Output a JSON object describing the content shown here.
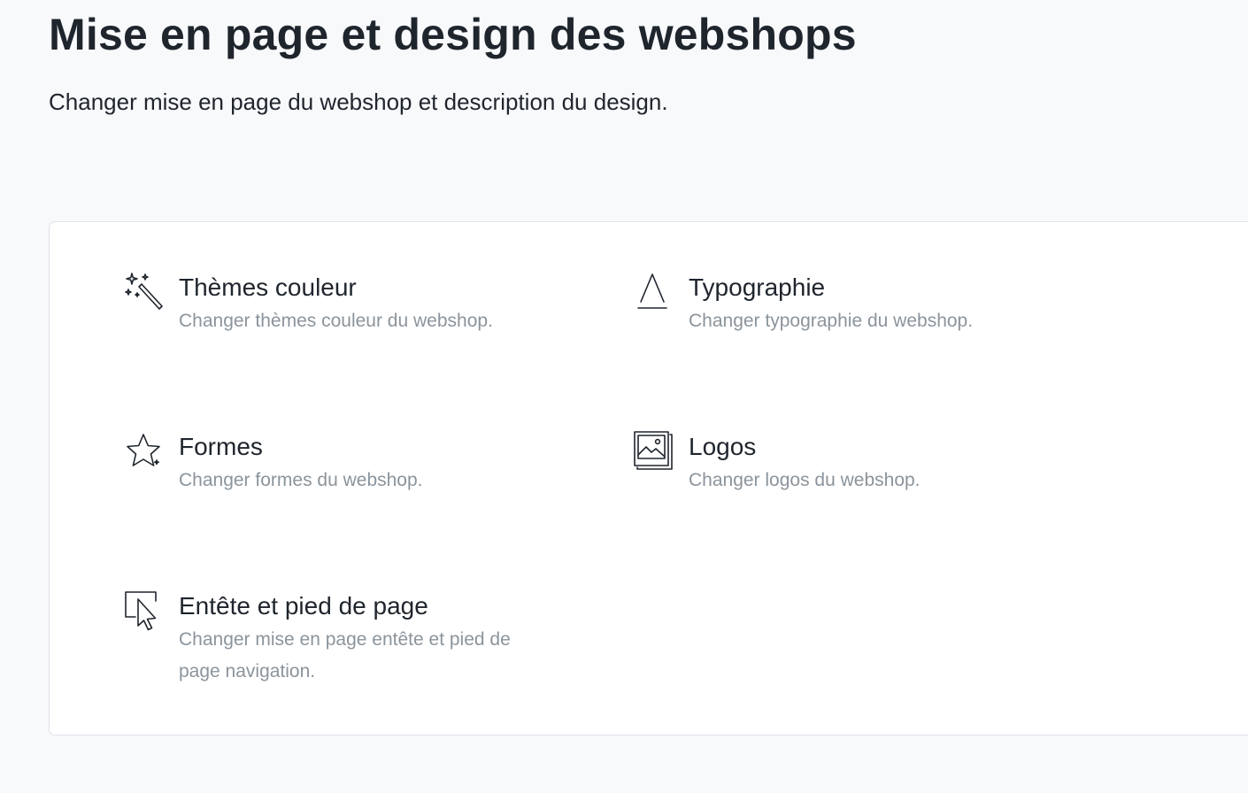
{
  "header": {
    "title": "Mise en page et design des webshops",
    "subtitle": "Changer mise en page du webshop et description du design."
  },
  "options": [
    {
      "title": "Thèmes couleur",
      "description": "Changer thèmes couleur du webshop.",
      "icon": "magic-wand-icon"
    },
    {
      "title": "Typographie",
      "description": "Changer typographie du webshop.",
      "icon": "typography-icon"
    },
    {
      "title": "Formes",
      "description": "Changer formes du webshop.",
      "icon": "star-icon"
    },
    {
      "title": "Logos",
      "description": "Changer logos du webshop.",
      "icon": "image-stack-icon"
    },
    {
      "title": "Entête et pied de page",
      "description": "Changer mise en page entête et pied de page navigation.",
      "icon": "cursor-frame-icon"
    }
  ]
}
